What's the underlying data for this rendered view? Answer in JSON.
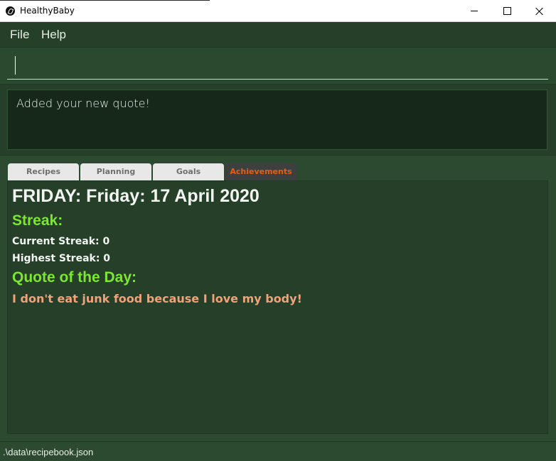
{
  "window": {
    "title": "HealthyBaby"
  },
  "menu": {
    "file": "File",
    "help": "Help"
  },
  "command": {
    "value": ""
  },
  "result": {
    "message": "Added your new quote!"
  },
  "tabs": [
    {
      "label": "Recipes",
      "active": false
    },
    {
      "label": "Planning",
      "active": false
    },
    {
      "label": "Goals",
      "active": false
    },
    {
      "label": "Achievements",
      "active": true
    }
  ],
  "achievements": {
    "date_heading": "FRIDAY: Friday: 17 April 2020",
    "streak_heading": "Streak:",
    "current_streak": "Current Streak: 0",
    "highest_streak": "Highest Streak: 0",
    "quote_heading": "Quote of the Day:",
    "quote": "I don't eat junk food because I love my body!"
  },
  "status": {
    "path": ".\\data\\recipebook.json"
  },
  "colors": {
    "background": "#2c4a30",
    "heading_green": "#7ce82a",
    "quote_orange": "#f0a27a",
    "active_tab_text": "#e55e12"
  }
}
